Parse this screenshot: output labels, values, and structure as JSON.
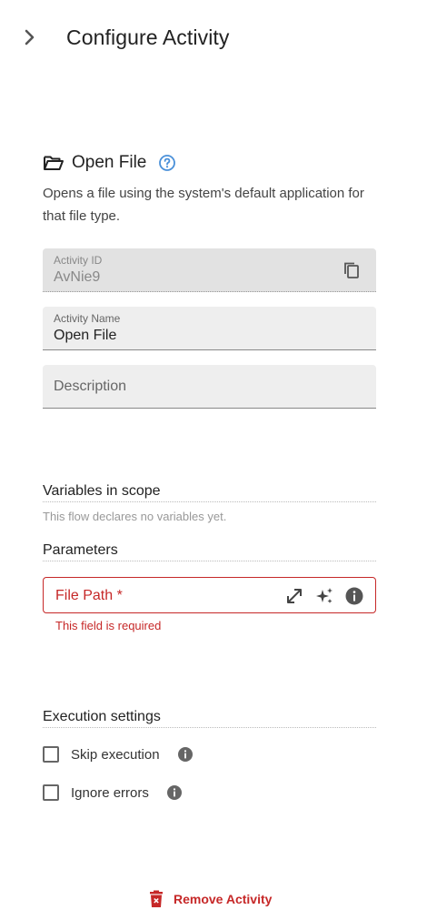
{
  "header": {
    "title": "Configure Activity",
    "collapse_icon": "chevron-right-icon"
  },
  "activity": {
    "title": "Open File",
    "icon": "folder-open-icon",
    "description": "Opens a file using the system's default application for that file type."
  },
  "fields": {
    "activity_id": {
      "label": "Activity ID",
      "value": "AvNie9"
    },
    "activity_name": {
      "label": "Activity Name",
      "value": "Open File"
    },
    "description": {
      "placeholder": "Description"
    }
  },
  "variables": {
    "title": "Variables in scope",
    "empty_text": "This flow declares no variables yet."
  },
  "parameters": {
    "title": "Parameters",
    "file_path": {
      "label": "File Path",
      "required_mark": "*",
      "error": "This field is required"
    }
  },
  "execution": {
    "title": "Execution settings",
    "skip_label": "Skip execution",
    "ignore_label": "Ignore errors"
  },
  "remove_label": "Remove Activity",
  "colors": {
    "error": "#c62828",
    "help": "#4a90d9",
    "field_bg": "#eeeeee"
  }
}
